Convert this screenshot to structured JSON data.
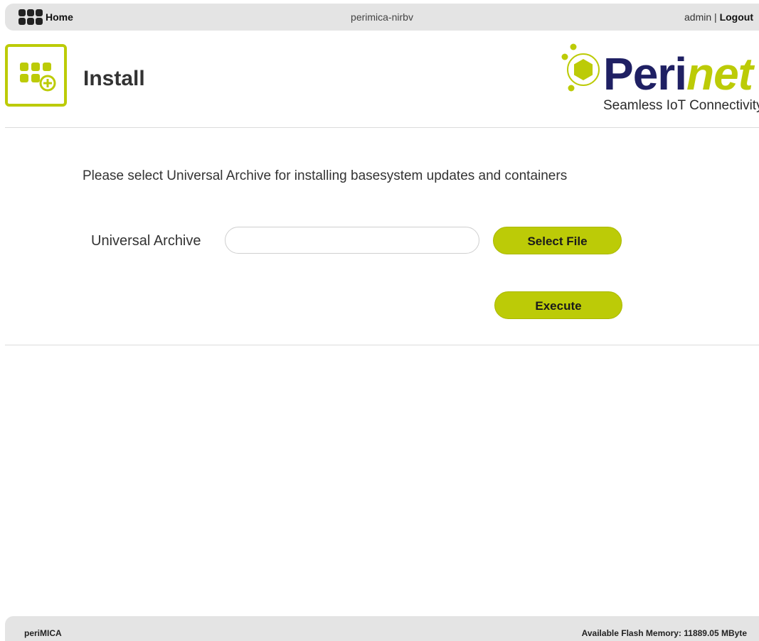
{
  "topbar": {
    "home_label": "Home",
    "host": "perimica-nirbv",
    "user": "admin",
    "separator": " | ",
    "logout_label": "Logout"
  },
  "header": {
    "title": "Install",
    "logo_peri": "Peri",
    "logo_net": "net",
    "logo_tagline": "Seamless IoT Connectivity"
  },
  "main": {
    "instruction": "Please select Universal Archive for installing basesystem updates and containers",
    "archive_label": "Universal Archive",
    "archive_value": "",
    "select_button": "Select File",
    "execute_button": "Execute"
  },
  "footer": {
    "app_name": "periMICA",
    "flash_memory": "Available Flash Memory: 11889.05 MByte"
  },
  "colors": {
    "accent": "#bccb07",
    "brand_dark": "#1f2063",
    "bar_bg": "#e4e4e4"
  },
  "icons": [
    "home-grid-icon",
    "install-app-icon",
    "perinet-hexagon-icon"
  ]
}
